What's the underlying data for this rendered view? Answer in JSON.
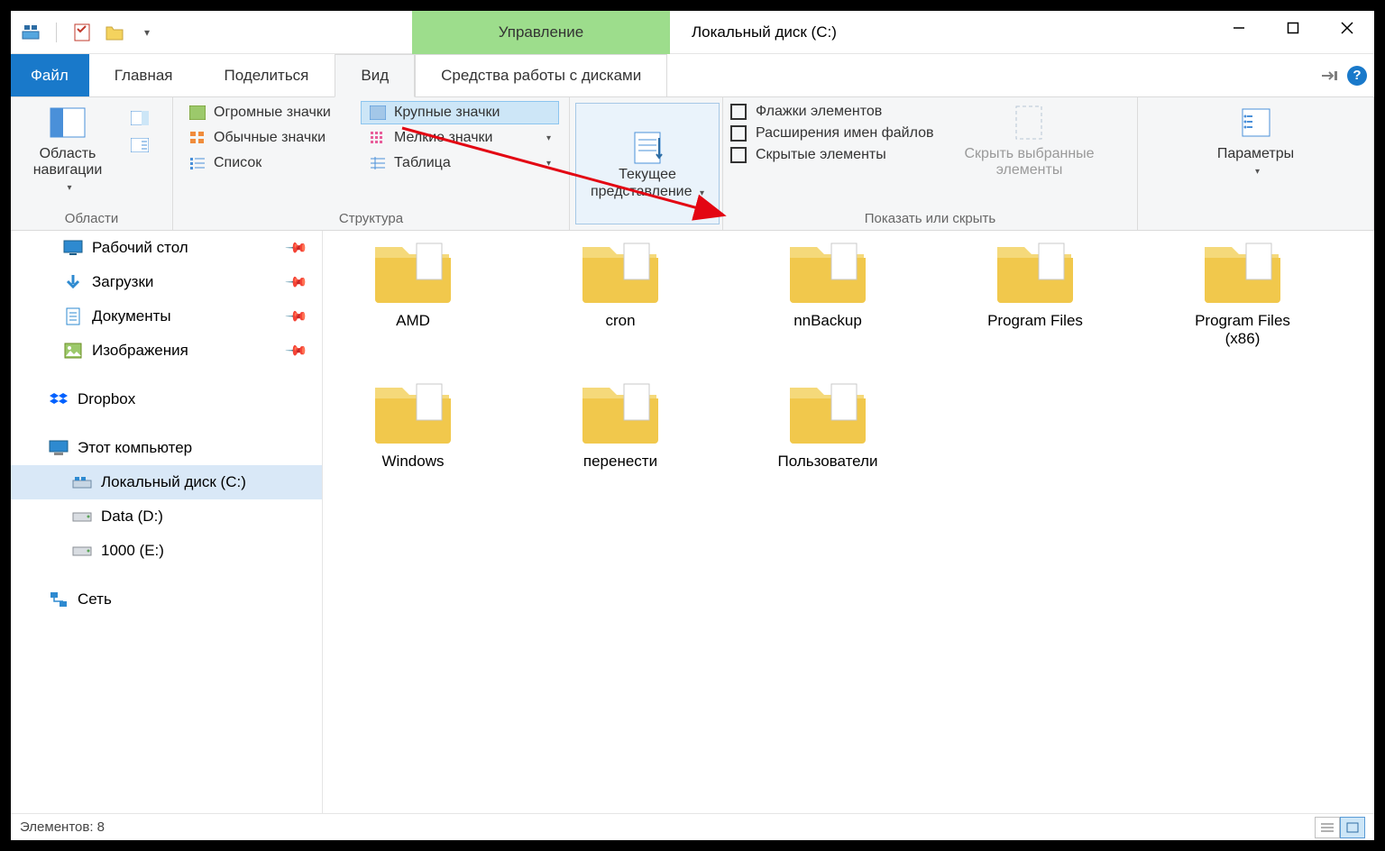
{
  "titlebar": {
    "contextual_group": "Управление",
    "window_title": "Локальный диск (C:)"
  },
  "tabs": {
    "file": "Файл",
    "main": "Главная",
    "share": "Поделиться",
    "view": "Вид",
    "drive_tools": "Средства работы с дисками"
  },
  "ribbon": {
    "panes_group": "Области",
    "nav_pane": "Область навигации",
    "layout_group": "Структура",
    "layout": {
      "extra_large": "Огромные значки",
      "large": "Крупные значки",
      "medium": "Обычные значки",
      "small": "Мелкие значки",
      "list": "Список",
      "details": "Таблица"
    },
    "current_view": "Текущее представление",
    "show_hide_group": "Показать или скрыть",
    "item_checkboxes": "Флажки элементов",
    "file_ext": "Расширения имен файлов",
    "hidden_items": "Скрытые элементы",
    "hide_selected": "Скрыть выбранные элементы",
    "options": "Параметры"
  },
  "sidebar": {
    "desktop": "Рабочий стол",
    "downloads": "Загрузки",
    "documents": "Документы",
    "pictures": "Изображения",
    "dropbox": "Dropbox",
    "this_pc": "Этот компьютер",
    "drive_c": "Локальный диск (C:)",
    "drive_d": "Data (D:)",
    "drive_e": "1000 (E:)",
    "network": "Сеть"
  },
  "folders": [
    "AMD",
    "cron",
    "nnBackup",
    "Program Files",
    "Program Files (x86)",
    "Windows",
    "перенести",
    "Пользователи"
  ],
  "statusbar": {
    "count_label": "Элементов: 8"
  }
}
